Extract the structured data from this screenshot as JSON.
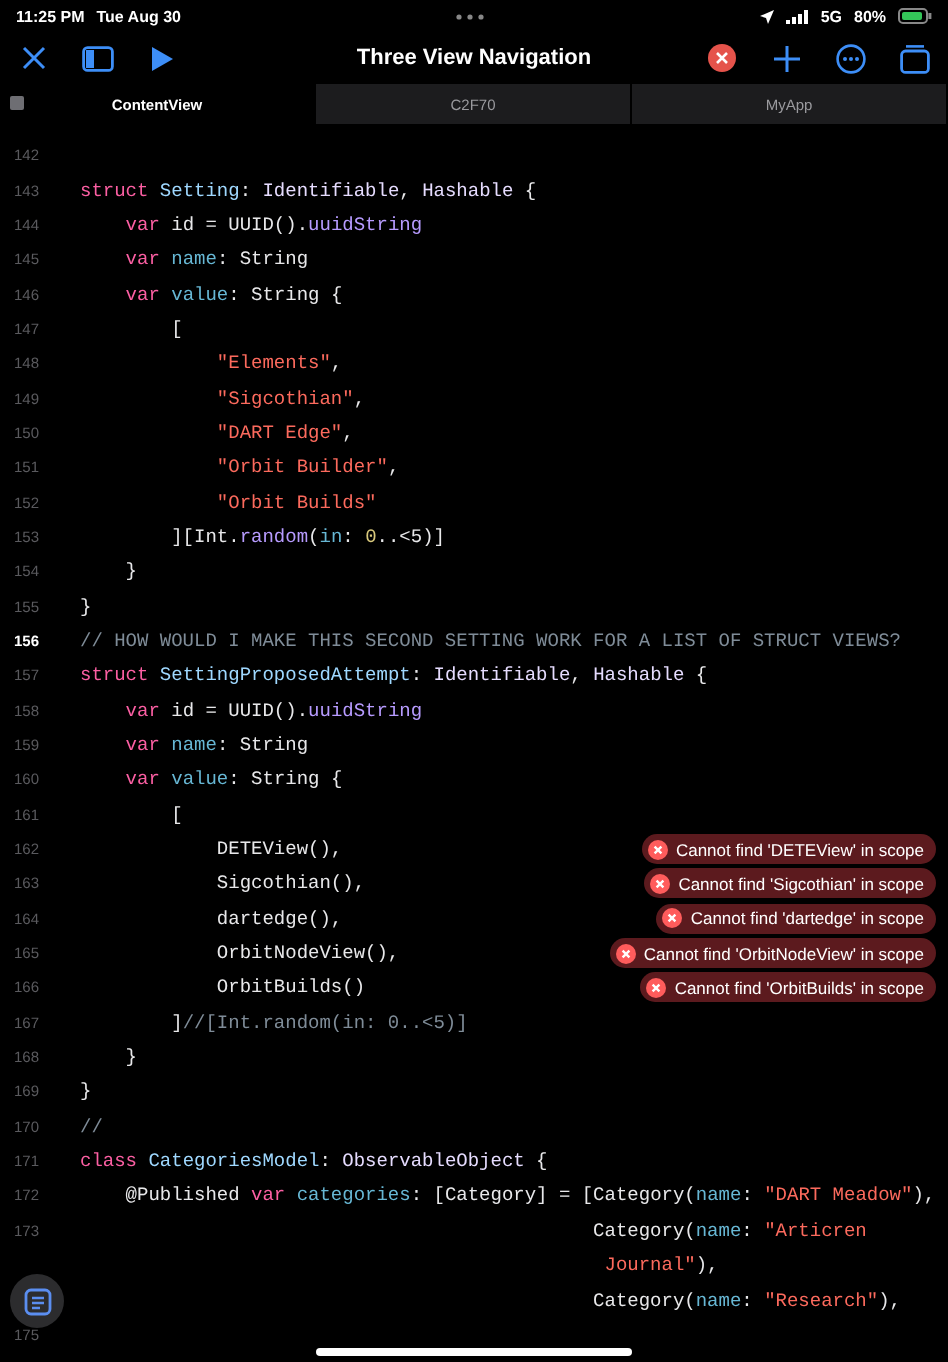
{
  "status_bar": {
    "time": "11:25 PM",
    "date": "Tue Aug 30",
    "network": "5G",
    "battery": "80%"
  },
  "toolbar": {
    "title": "Three View Navigation"
  },
  "tabs": [
    {
      "label": "ContentView",
      "selected": true
    },
    {
      "label": "C2F70",
      "selected": false
    },
    {
      "label": "MyApp",
      "selected": false
    }
  ],
  "editor": {
    "lines": [
      {
        "number": "142",
        "current": false
      },
      {
        "number": "143",
        "current": false,
        "tokens": [
          {
            "kind": "kw",
            "text": "struct"
          },
          {
            "kind": "decl",
            "text": " Setting"
          },
          {
            "kind": "plain",
            "text": ": "
          },
          {
            "kind": "type",
            "text": "Identifiable"
          },
          {
            "kind": "plain",
            "text": ", "
          },
          {
            "kind": "type",
            "text": "Hashable"
          },
          {
            "kind": "plain",
            "text": " {"
          }
        ]
      },
      {
        "number": "144",
        "current": false,
        "tokens": [
          {
            "kind": "kw",
            "text": "    var"
          },
          {
            "kind": "plain",
            "text": " id = UUID()."
          },
          {
            "kind": "member",
            "text": "uuidString"
          }
        ]
      },
      {
        "number": "145",
        "current": false,
        "tokens": [
          {
            "kind": "kw",
            "text": "    var"
          },
          {
            "kind": "field",
            "text": " name"
          },
          {
            "kind": "plain",
            "text": ": String"
          }
        ]
      },
      {
        "number": "146",
        "current": false,
        "tokens": [
          {
            "kind": "kw",
            "text": "    var"
          },
          {
            "kind": "field",
            "text": " value"
          },
          {
            "kind": "plain",
            "text": ": String {"
          }
        ]
      },
      {
        "number": "147",
        "current": false,
        "tokens": [
          {
            "kind": "plain",
            "text": "        ["
          }
        ]
      },
      {
        "number": "148",
        "current": false,
        "tokens": [
          {
            "kind": "str",
            "text": "            \"Elements\""
          },
          {
            "kind": "plain",
            "text": ","
          }
        ]
      },
      {
        "number": "149",
        "current": false,
        "tokens": [
          {
            "kind": "str",
            "text": "            \"Sigcothian\""
          },
          {
            "kind": "plain",
            "text": ","
          }
        ]
      },
      {
        "number": "150",
        "current": false,
        "tokens": [
          {
            "kind": "str",
            "text": "            \"DART Edge\""
          },
          {
            "kind": "plain",
            "text": ","
          }
        ]
      },
      {
        "number": "151",
        "current": false,
        "tokens": [
          {
            "kind": "str",
            "text": "            \"Orbit Builder\""
          },
          {
            "kind": "plain",
            "text": ","
          }
        ]
      },
      {
        "number": "152",
        "current": false,
        "tokens": [
          {
            "kind": "str",
            "text": "            \"Orbit Builds\""
          }
        ]
      },
      {
        "number": "153",
        "current": false,
        "tokens": [
          {
            "kind": "plain",
            "text": "        ][Int."
          },
          {
            "kind": "member",
            "text": "random"
          },
          {
            "kind": "plain",
            "text": "("
          },
          {
            "kind": "field",
            "text": "in"
          },
          {
            "kind": "plain",
            "text": ": "
          },
          {
            "kind": "num",
            "text": "0"
          },
          {
            "kind": "plain",
            "text": "..<5)]"
          }
        ]
      },
      {
        "number": "154",
        "current": false,
        "tokens": [
          {
            "kind": "plain",
            "text": "    }"
          }
        ]
      },
      {
        "number": "155",
        "current": false,
        "tokens": [
          {
            "kind": "plain",
            "text": "}"
          }
        ]
      },
      {
        "number": "156",
        "current": true,
        "tokens": [
          {
            "kind": "comment",
            "text": "// HOW WOULD I MAKE THIS SECOND SETTING WORK FOR A LIST OF STRUCT VIEWS?"
          }
        ]
      },
      {
        "number": "157",
        "current": false,
        "tokens": [
          {
            "kind": "kw",
            "text": "struct"
          },
          {
            "kind": "decl",
            "text": " SettingProposedAttempt"
          },
          {
            "kind": "plain",
            "text": ": "
          },
          {
            "kind": "type",
            "text": "Identifiable"
          },
          {
            "kind": "plain",
            "text": ", "
          },
          {
            "kind": "type",
            "text": "Hashable"
          },
          {
            "kind": "plain",
            "text": " {"
          }
        ]
      },
      {
        "number": "158",
        "current": false,
        "tokens": [
          {
            "kind": "kw",
            "text": "    var"
          },
          {
            "kind": "plain",
            "text": " id = UUID()."
          },
          {
            "kind": "member",
            "text": "uuidString"
          }
        ]
      },
      {
        "number": "159",
        "current": false,
        "tokens": [
          {
            "kind": "kw",
            "text": "    var"
          },
          {
            "kind": "field",
            "text": " name"
          },
          {
            "kind": "plain",
            "text": ": String"
          }
        ]
      },
      {
        "number": "160",
        "current": false,
        "tokens": [
          {
            "kind": "kw",
            "text": "    var"
          },
          {
            "kind": "field",
            "text": " value"
          },
          {
            "kind": "plain",
            "text": ": String {"
          }
        ]
      },
      {
        "number": "161",
        "current": false,
        "tokens": [
          {
            "kind": "plain",
            "text": "        ["
          }
        ]
      },
      {
        "number": "162",
        "current": false,
        "tokens": [
          {
            "kind": "plain",
            "text": "            DETEView(),"
          }
        ],
        "error": "Cannot find 'DETEView' in scope"
      },
      {
        "number": "163",
        "current": false,
        "tokens": [
          {
            "kind": "plain",
            "text": "            Sigcothian(),"
          }
        ],
        "error": "Cannot find 'Sigcothian' in scope"
      },
      {
        "number": "164",
        "current": false,
        "tokens": [
          {
            "kind": "plain",
            "text": "            dartedge(),"
          }
        ],
        "error": "Cannot find 'dartedge' in scope"
      },
      {
        "number": "165",
        "current": false,
        "tokens": [
          {
            "kind": "plain",
            "text": "            OrbitNodeView(),"
          }
        ],
        "error": "Cannot find 'OrbitNodeView' in scope"
      },
      {
        "number": "166",
        "current": false,
        "tokens": [
          {
            "kind": "plain",
            "text": "            OrbitBuilds()"
          }
        ],
        "error": "Cannot find 'OrbitBuilds' in scope"
      },
      {
        "number": "167",
        "current": false,
        "tokens": [
          {
            "kind": "plain",
            "text": "        ]"
          },
          {
            "kind": "comment",
            "text": "//[Int.random(in: 0..<5)]"
          }
        ]
      },
      {
        "number": "168",
        "current": false,
        "tokens": [
          {
            "kind": "plain",
            "text": "    }"
          }
        ]
      },
      {
        "number": "169",
        "current": false,
        "tokens": [
          {
            "kind": "plain",
            "text": "}"
          }
        ]
      },
      {
        "number": "170",
        "current": false,
        "tokens": [
          {
            "kind": "comment",
            "text": "//"
          }
        ]
      },
      {
        "number": "171",
        "current": false,
        "tokens": [
          {
            "kind": "kw",
            "text": "class"
          },
          {
            "kind": "decl",
            "text": " CategoriesModel"
          },
          {
            "kind": "plain",
            "text": ": "
          },
          {
            "kind": "type",
            "text": "ObservableObject"
          },
          {
            "kind": "plain",
            "text": " {"
          }
        ]
      },
      {
        "number": "172",
        "current": false,
        "tokens": [
          {
            "kind": "plain",
            "text": "    @Published "
          },
          {
            "kind": "kw",
            "text": "var"
          },
          {
            "kind": "field",
            "text": " categories"
          },
          {
            "kind": "plain",
            "text": ": [Category] = [Category("
          },
          {
            "kind": "field",
            "text": "name"
          },
          {
            "kind": "plain",
            "text": ": "
          },
          {
            "kind": "str",
            "text": "\"DART Meadow\""
          },
          {
            "kind": "plain",
            "text": "),"
          }
        ]
      },
      {
        "number": "173",
        "current": false,
        "tokens": [
          {
            "kind": "plain",
            "text": "                                             Category("
          },
          {
            "kind": "field",
            "text": "name"
          },
          {
            "kind": "plain",
            "text": ": "
          },
          {
            "kind": "str",
            "text": "\"Articren"
          }
        ]
      },
      {
        "tokens": [
          {
            "kind": "str",
            "text": "                                              Journal\""
          },
          {
            "kind": "plain",
            "text": "),"
          }
        ]
      },
      {
        "tokens": [
          {
            "kind": "plain",
            "text": "                                             Category("
          },
          {
            "kind": "field",
            "text": "name"
          },
          {
            "kind": "plain",
            "text": ": "
          },
          {
            "kind": "str",
            "text": "\"Research\""
          },
          {
            "kind": "plain",
            "text": "),"
          }
        ]
      },
      {
        "number": "175",
        "current": false
      }
    ]
  }
}
